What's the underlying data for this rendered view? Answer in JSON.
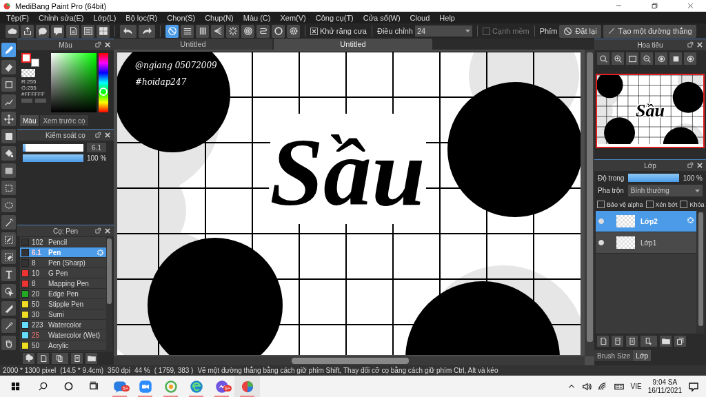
{
  "window": {
    "title": "MediBang Paint Pro (64bit)"
  },
  "menu": [
    "Tệp(F)",
    "Chỉnh sửa(E)",
    "Lớp(L)",
    "Bộ lọc(R)",
    "Chọn(S)",
    "Chụp(N)",
    "Màu (C)",
    "Xem(V)",
    "Công cụ(T)",
    "Cửa sổ(W)",
    "Cloud",
    "Help"
  ],
  "toolbar": {
    "buttons": [
      {
        "kind": "cloud"
      },
      {
        "kind": "share"
      },
      {
        "kind": "speech"
      },
      {
        "kind": "comment"
      },
      {
        "kind": "page"
      },
      {
        "kind": "list"
      },
      {
        "kind": "grid"
      },
      {
        "kind": "undo"
      },
      {
        "kind": "redo"
      }
    ],
    "snaps": [
      {
        "kind": "off",
        "selected": true
      },
      {
        "kind": "parallel",
        "selected": false
      },
      {
        "kind": "vertical",
        "selected": false
      },
      {
        "kind": "vanish",
        "selected": false
      },
      {
        "kind": "radial",
        "selected": false
      },
      {
        "kind": "concentric",
        "selected": false
      },
      {
        "kind": "curve",
        "selected": false
      },
      {
        "kind": "circle",
        "selected": false
      },
      {
        "kind": "gear",
        "selected": false
      }
    ],
    "antialias": {
      "label": "Khử răng cưa",
      "checked": true
    },
    "adjust": {
      "label": "Điều chỉnh",
      "value": "24"
    },
    "soft_edge": {
      "label": "Cạnh mềm",
      "checked": false,
      "disabled": true
    },
    "keys_label": "Phím",
    "reset_button": "Đặt lại",
    "line_button": "Tạo một đường thẳng"
  },
  "tools": [
    {
      "kind": "brush",
      "selected": true
    },
    {
      "kind": "eraser",
      "selected": false
    },
    {
      "kind": "dot",
      "selected": false
    },
    {
      "kind": "line",
      "selected": false
    },
    {
      "kind": "move",
      "selected": false
    },
    {
      "kind": "fillrect",
      "selected": false
    },
    {
      "kind": "bucket",
      "selected": false
    },
    {
      "kind": "gradient",
      "selected": false
    },
    {
      "kind": "selrect",
      "selected": false
    },
    {
      "kind": "lasso",
      "selected": false
    },
    {
      "kind": "wand",
      "selected": false
    },
    {
      "kind": "selpen",
      "selected": false
    },
    {
      "kind": "seleraser",
      "selected": false
    },
    {
      "kind": "text",
      "selected": false
    },
    {
      "kind": "operation",
      "selected": false
    },
    {
      "kind": "divide",
      "selected": false
    },
    {
      "kind": "dropper",
      "selected": false
    },
    {
      "kind": "hand",
      "selected": false
    }
  ],
  "color_panel": {
    "title": "Màu",
    "r": "R:255",
    "g": "G:255",
    "hex": "#FFFFFF",
    "hue": {
      "level": 0.35
    },
    "tabs": [
      {
        "label": "Màu",
        "selected": true
      },
      {
        "label": "Xem trước cọ",
        "selected": false
      }
    ]
  },
  "brush_control": {
    "title": "Kiểm soát cọ",
    "size": {
      "level": 0.05,
      "value": "6.1"
    },
    "opacity": {
      "level": 1,
      "reading": "100 %"
    }
  },
  "brush_panel": {
    "title": "Cọ: Pen",
    "brushes": [
      {
        "size": "102",
        "name": "Pencil",
        "color": "#333333",
        "size_modified": false,
        "selected": false
      },
      {
        "size": "6.1",
        "name": "Pen",
        "color": "#333333",
        "size_modified": true,
        "selected": true
      },
      {
        "size": "8",
        "name": "Pen (Sharp)",
        "color": "#333333",
        "size_modified": false,
        "selected": false
      },
      {
        "size": "10",
        "name": "G Pen",
        "color": "#ee3333",
        "size_modified": false,
        "selected": false
      },
      {
        "size": "8",
        "name": "Mapping Pen",
        "color": "#ee3333",
        "size_modified": false,
        "selected": false
      },
      {
        "size": "20",
        "name": "Edge Pen",
        "color": "#22aa22",
        "size_modified": false,
        "selected": false
      },
      {
        "size": "50",
        "name": "Stipple Pen",
        "color": "#eedd22",
        "size_modified": false,
        "selected": false
      },
      {
        "size": "30",
        "name": "Sumi",
        "color": "#eedd22",
        "size_modified": false,
        "selected": false
      },
      {
        "size": "223",
        "name": "Watercolor",
        "color": "#66ddff",
        "size_modified": false,
        "selected": false
      },
      {
        "size": "25",
        "name": "Watercolor (Wet)",
        "color": "#66ddff",
        "size_modified": true,
        "selected": false
      },
      {
        "size": "50",
        "name": "Acrylic",
        "color": "#eedd22",
        "size_modified": false,
        "selected": false
      }
    ]
  },
  "canvas": {
    "tabs": [
      {
        "label": "Untitled",
        "selected": false
      },
      {
        "label": "Untitled",
        "selected": true
      }
    ],
    "title_art": "Sầu",
    "signature": [
      "@ngiang 05072009",
      "#hoidap247"
    ]
  },
  "navigator": {
    "title": "Hoa tiêu",
    "preview_text": "Sầu"
  },
  "layers": {
    "title": "Lớp",
    "opacity_label": "Độ trong",
    "opacity": {
      "level": 1,
      "reading": "100 %"
    },
    "blend_label": "Pha trộn",
    "blend": "Bình thường",
    "options": [
      {
        "label": "Bảo vệ alpha",
        "checked": false
      },
      {
        "label": "Xén bớt",
        "checked": false
      },
      {
        "label": "Khóa",
        "checked": false
      }
    ],
    "items": [
      {
        "name": "Lớp2",
        "selected": true,
        "visible": true
      },
      {
        "name": "Lớp1",
        "selected": false,
        "visible": true
      }
    ],
    "tabs": [
      {
        "label": "Brush Size",
        "selected": false
      },
      {
        "label": "Lớp",
        "selected": true
      }
    ]
  },
  "status_bar": [
    "2000 * 1300 pixel",
    "(14.5 * 9.4cm)",
    "350 dpi",
    "44 %",
    "( 1759, 383 )",
    "Vẽ một đường thẳng bằng cách giữ phím Shift, Thay đổi cỡ cọ bằng cách giữ phím Ctrl, Alt và kéo"
  ],
  "taskbar": {
    "apps": [
      {
        "kind": "chat",
        "badge": "5+",
        "selected": false
      },
      {
        "kind": "video",
        "selected": false
      },
      {
        "kind": "leaf",
        "selected": false
      },
      {
        "kind": "browser",
        "selected": false
      },
      {
        "kind": "bubble",
        "badge": "9+",
        "selected": false
      },
      {
        "kind": "paint",
        "selected": true
      }
    ],
    "language": "VIE",
    "time": "9:04 SA",
    "date": "16/11/2021"
  }
}
